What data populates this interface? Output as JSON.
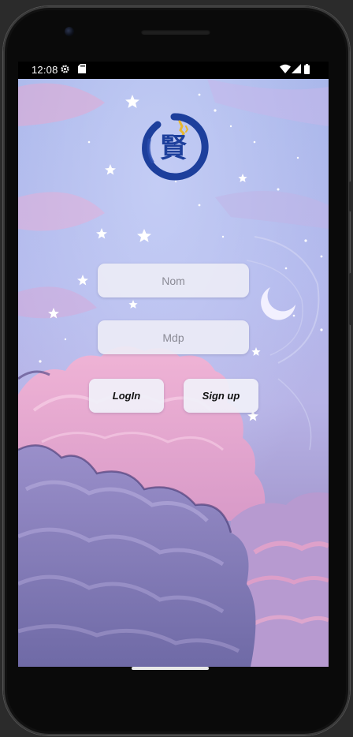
{
  "status_bar": {
    "time": "12:08",
    "icons": [
      "settings-gear-icon",
      "sd-card-icon",
      "wifi-icon",
      "cell-signal-icon",
      "battery-icon"
    ]
  },
  "logo": {
    "glyph": "賢",
    "color": "#1d3f9c",
    "accent": "#e8b830"
  },
  "form": {
    "name_placeholder": "Nom",
    "password_placeholder": "Mdp",
    "login_label": "LogIn",
    "signup_label": "Sign up"
  },
  "colors": {
    "sky": "#aab4ea",
    "cloud_pink": "#e8a8cf",
    "cloud_purple": "#8c82bc",
    "field_bg": "#ececf6"
  }
}
